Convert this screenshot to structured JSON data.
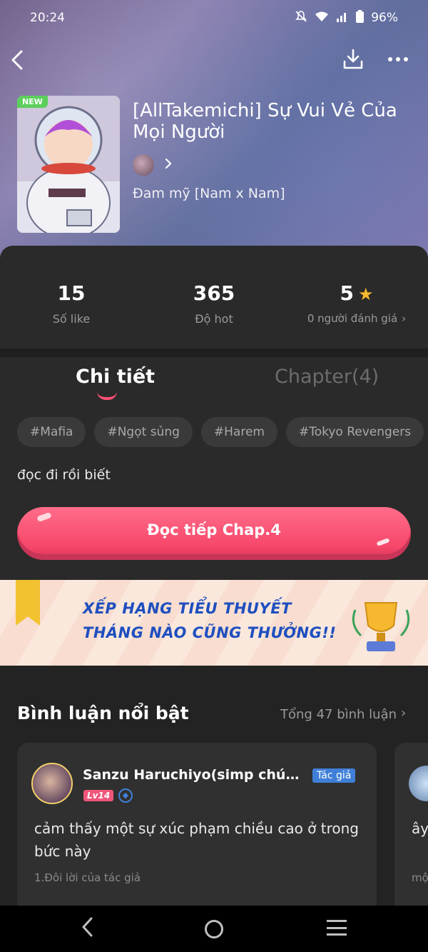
{
  "status_bar": {
    "time": "20:24",
    "battery": "96%"
  },
  "comic": {
    "badge": "NEW",
    "title": "[AllTakemichi] Sự Vui Vẻ Của Mọi Người",
    "genre": "Đam mỹ [Nam x Nam]"
  },
  "stats": [
    {
      "value": "15",
      "label": "Số like"
    },
    {
      "value": "365",
      "label": "Độ hot"
    },
    {
      "value": "5",
      "label": "0 người đánh giá"
    }
  ],
  "tabs": {
    "detail": "Chi tiết",
    "chapters": "Chapter(4)"
  },
  "tags": [
    "#Mafia",
    "#Ngọt sủng",
    "#Harem",
    "#Tokyo Revengers"
  ],
  "description": "đọc đi rồi biết",
  "read_button": "Đọc tiếp Chap.4",
  "banner": {
    "line1": "XẾP HẠNG TIỂU THUYẾT",
    "line2": "THÁNG NÀO CŨNG THƯỞNG!!"
  },
  "comments": {
    "title": "Bình luận nổi bật",
    "total": "Tổng 47 bình luận",
    "items": [
      {
        "name": "Sanzu Haruchiyo(simp chúa t...",
        "role": "Tác giả",
        "level": "Lv14",
        "text": "cảm thấy một sự xúc phạm chiều cao ở trong bức này",
        "meta": "1.Đôi lời của tác giả"
      },
      {
        "text": "ây... kh",
        "meta": "mộ"
      }
    ]
  },
  "colors": {
    "accent": "#f6476a",
    "background": "#232323",
    "panel": "#2a2a2a",
    "star": "#f5b82e",
    "role_badge": "#3f7fd8"
  }
}
